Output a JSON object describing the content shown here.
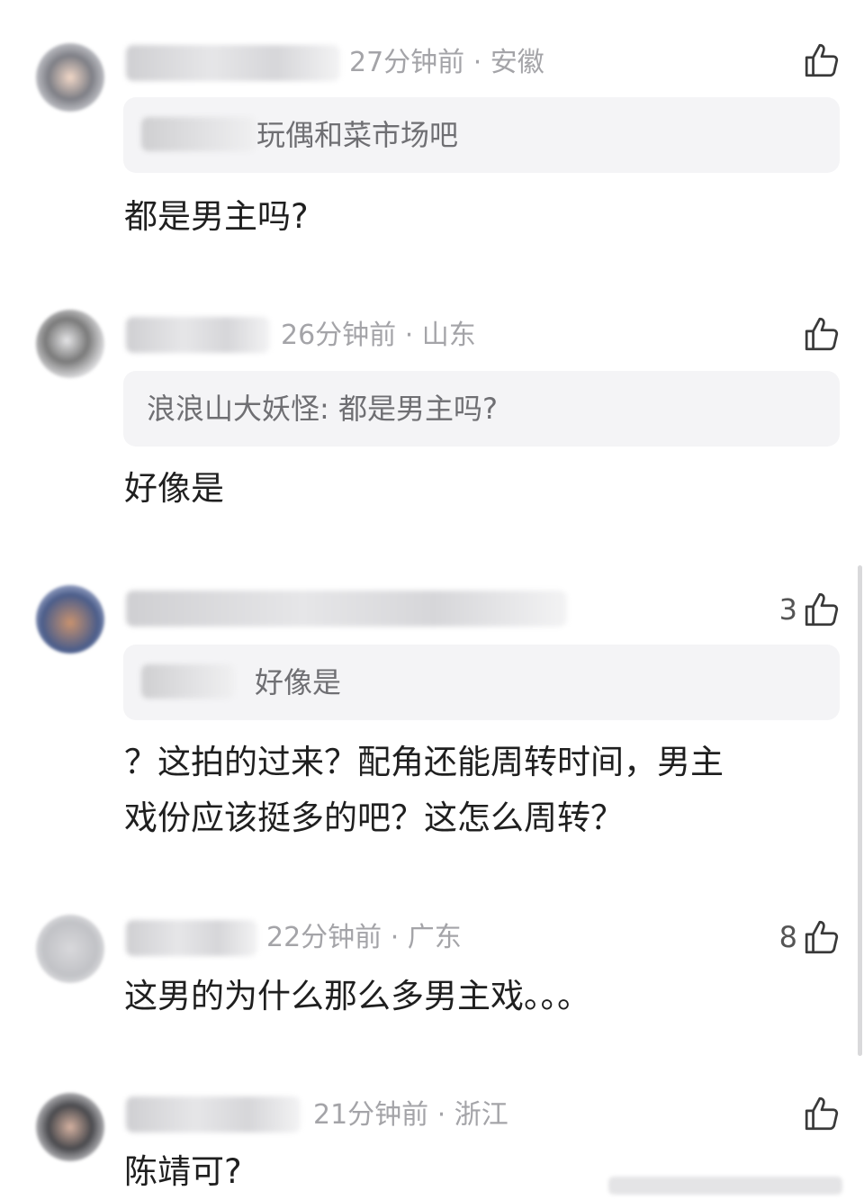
{
  "comments": [
    {
      "time_location": "27分钟前 · 安徽",
      "likes": "",
      "quote_text": "玩偶和菜市场吧",
      "text": "都是男主吗?"
    },
    {
      "time_location": "26分钟前 · 山东",
      "likes": "",
      "quote_text": "浪浪山大妖怪:  都是男主吗?",
      "text": "好像是"
    },
    {
      "time_location": "",
      "likes": "3",
      "quote_text": "好像是",
      "text_line1": "？这拍的过来？配角还能周转时间，男主",
      "text_line2": "戏份应该挺多的吧？这怎么周转？"
    },
    {
      "time_location": "22分钟前 · 广东",
      "likes": "8",
      "text": "这男的为什么那么多男主戏。。。"
    },
    {
      "time_location": "21分钟前 · 浙江",
      "likes": "",
      "text": "陈靖可?"
    }
  ],
  "icons": {
    "like": "thumbs-up-icon"
  },
  "colors": {
    "text": "#1f1f1f",
    "meta": "#a4a4a8",
    "quote_bg": "#f4f4f6"
  }
}
